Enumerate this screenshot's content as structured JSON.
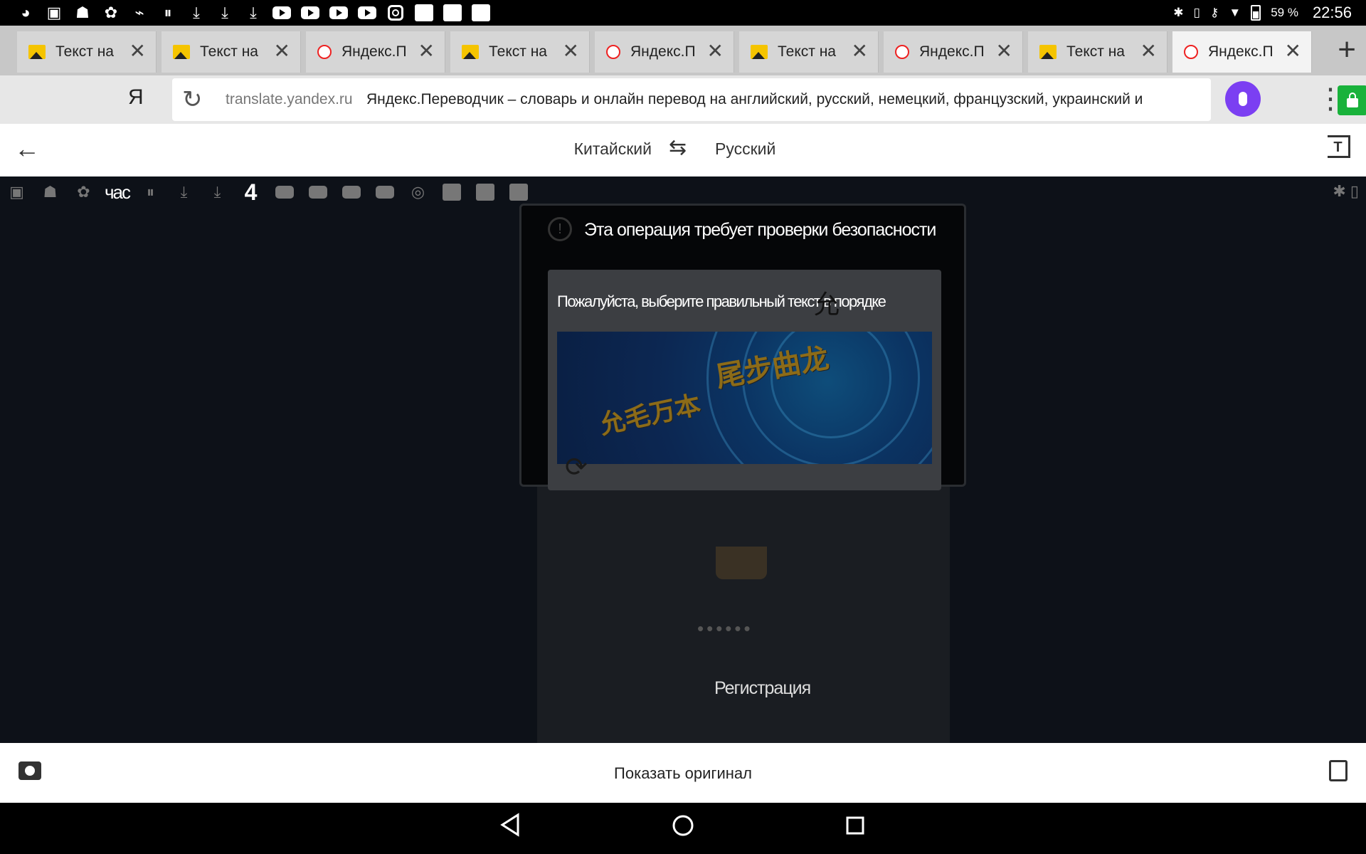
{
  "status_bar": {
    "battery": "59 %",
    "time": "22:56"
  },
  "tabs": [
    {
      "title": "Текст на",
      "favicon": "image-icon",
      "active": false
    },
    {
      "title": "Текст на",
      "favicon": "image-icon",
      "active": false
    },
    {
      "title": "Яндекс.П",
      "favicon": "yandex-translate-icon",
      "active": false
    },
    {
      "title": "Текст на",
      "favicon": "image-icon",
      "active": false
    },
    {
      "title": "Яндекс.П",
      "favicon": "yandex-translate-icon",
      "active": false
    },
    {
      "title": "Текст на",
      "favicon": "image-icon",
      "active": false
    },
    {
      "title": "Яндекс.П",
      "favicon": "yandex-translate-icon",
      "active": false
    },
    {
      "title": "Текст на",
      "favicon": "image-icon",
      "active": false
    },
    {
      "title": "Яндекс.П",
      "favicon": "yandex-translate-icon",
      "active": true
    }
  ],
  "address_bar": {
    "logo": "Я",
    "domain": "translate.yandex.ru",
    "page_title": "Яндекс.Переводчик – словарь и онлайн перевод на английский, русский, немецкий, французский, украинский и"
  },
  "translate_bar": {
    "source_lang": "Китайский",
    "target_lang": "Русский"
  },
  "translated_screen": {
    "inner_status_hour": "час",
    "inner_status_number": "4",
    "dialog": {
      "title": "Эта операция требует проверки безопасности",
      "instruction": "Пожалуйста, выберите правильный текст в порядке",
      "target_char": "允",
      "captcha_word_1": "尾步曲龙",
      "captcha_word_2": "允毛万本"
    },
    "password_mask": "••••••",
    "register_label": "Регистрация"
  },
  "bottom_bar": {
    "show_original": "Показать оригинал"
  },
  "colors": {
    "mic": "#7b3ff2",
    "lock": "#19b23b",
    "captcha_text": "#8c6b18"
  }
}
